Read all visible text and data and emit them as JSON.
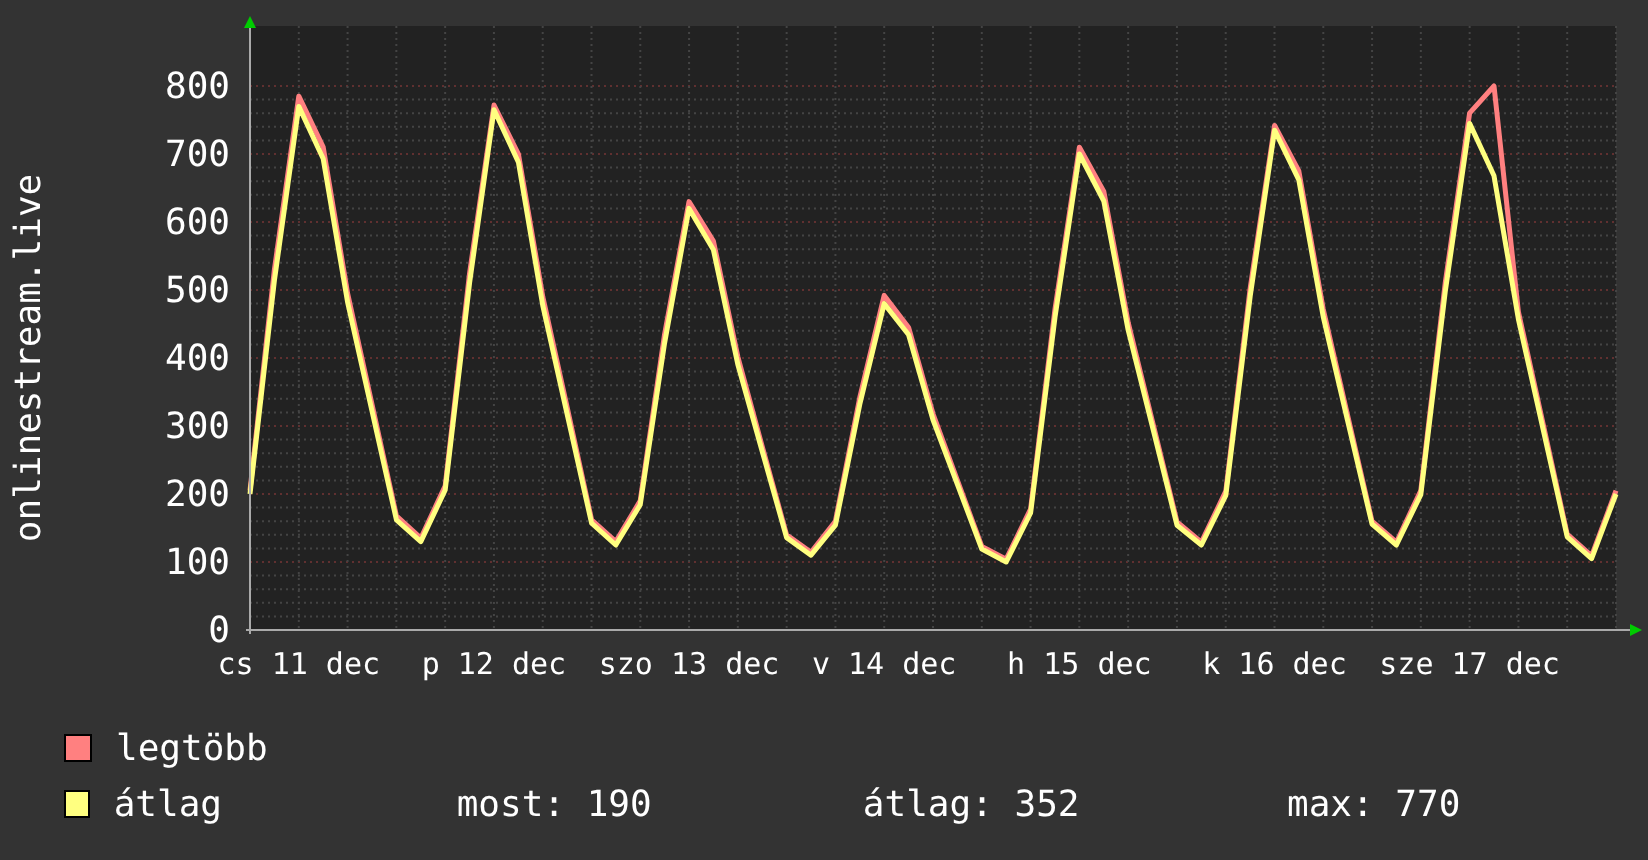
{
  "chart": {
    "chart_data": {
      "type": "line",
      "grid": true,
      "ylabel": "onlinestream.live",
      "ylim": [
        0,
        800
      ],
      "yticks": [
        0,
        100,
        200,
        300,
        400,
        500,
        600,
        700,
        800
      ],
      "categories": [
        null,
        null,
        "cs 11 dec",
        null,
        null,
        null,
        null,
        null,
        null,
        null,
        "p 12 dec",
        null,
        null,
        null,
        null,
        null,
        null,
        null,
        "szo 13 dec",
        null,
        null,
        null,
        null,
        null,
        null,
        null,
        "v 14 dec",
        null,
        null,
        null,
        null,
        null,
        null,
        null,
        "h 15 dec",
        null,
        null,
        null,
        null,
        null,
        null,
        null,
        "k 16 dec",
        null,
        null,
        null,
        null,
        null,
        null,
        null,
        "sze 17 dec",
        null,
        null,
        null,
        null,
        null,
        null
      ],
      "series": [
        {
          "name": "legtöbb",
          "color": "#ff8080",
          "values": [
            205,
            530,
            785,
            710,
            495,
            332,
            168,
            135,
            212,
            525,
            772,
            700,
            490,
            327,
            162,
            130,
            190,
            435,
            630,
            572,
            402,
            270,
            140,
            114,
            160,
            342,
            492,
            445,
            318,
            220,
            123,
            104,
            178,
            472,
            710,
            645,
            452,
            306,
            159,
            129,
            204,
            503,
            742,
            675,
            472,
            316,
            160,
            129,
            205,
            510,
            760,
            800,
            468,
            305,
            141,
            109,
            205
          ]
        },
        {
          "name": "átlag",
          "color": "#ffff80",
          "values": [
            200,
            514,
            770,
            693,
            482,
            322,
            162,
            130,
            206,
            511,
            765,
            688,
            477,
            317,
            157,
            125,
            184,
            422,
            620,
            559,
            391,
            263,
            136,
            110,
            154,
            332,
            480,
            434,
            309,
            214,
            119,
            100,
            172,
            460,
            700,
            631,
            441,
            298,
            154,
            125,
            198,
            491,
            735,
            662,
            461,
            308,
            156,
            125,
            199,
            497,
            745,
            668,
            457,
            297,
            137,
            105,
            200
          ]
        }
      ]
    }
  },
  "legend": {
    "stats": [
      {
        "label": "most: 190"
      },
      {
        "label": "átlag: 352"
      },
      {
        "label": "max: 770"
      }
    ]
  }
}
